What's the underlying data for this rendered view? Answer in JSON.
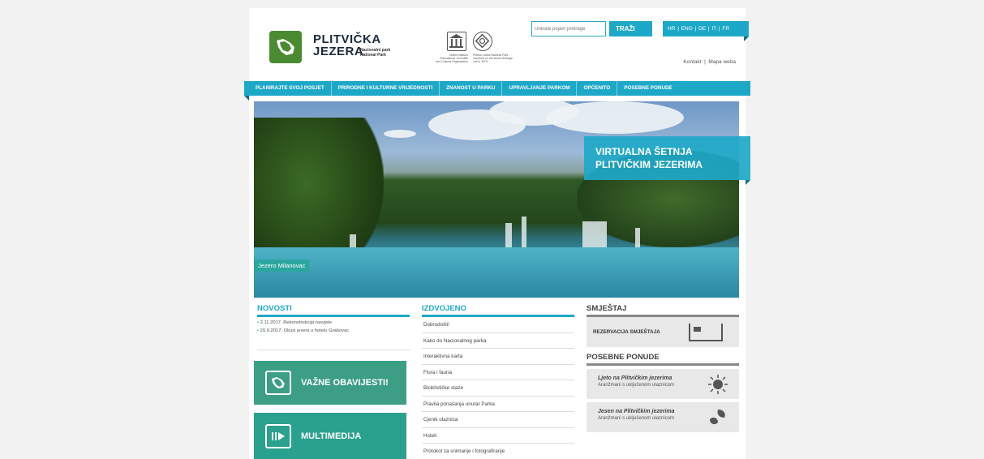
{
  "header": {
    "logo_title": "PLITVIČKA JEZERA",
    "logo_subtitle": "Nacionalni park National Park",
    "unesco_caption_left": "United Nations Educational, Scientific and Cultural Organization",
    "unesco_caption_right": "Plitvice Lakes National Park inscribed on the World Heritage List in 1979",
    "search_placeholder": "Unesite pojam pretrage",
    "search_button": "TRAŽI",
    "languages": "HR | ENG | DE | IT | FR",
    "contact": "Kontakt",
    "sitemap": "Mapa weba"
  },
  "nav": [
    "PLANIRAJTE SVOJ POSJET",
    "PRIRODNE I KULTURNE VRIJEDNOSTI",
    "ZNANOST U PARKU",
    "UPRAVLJANJE PARKOM",
    "OPĆENITO",
    "POSEBNE PONUDE"
  ],
  "hero": {
    "caption": "Jezero Milanovac",
    "virtual_tour_line1": "VIRTUALNA ŠETNJA",
    "virtual_tour_line2": "PLITVIČKIM JEZERIMA"
  },
  "news": {
    "title": "NOVOSTI",
    "items": [
      "2.11.2017. Rekonstrukcija rasvjete",
      "20.9.2017. Okusi jeseni u hotelu Grabovac"
    ]
  },
  "tiles": {
    "notices": "VAŽNE OBAVIJESTI!",
    "media": "MULTIMEDIJA"
  },
  "featured": {
    "title": "IZDVOJENO",
    "links": [
      "Dobrodošli!",
      "Kako do Nacionalnog parka",
      "Interaktivna karta",
      "Flora i fauna",
      "Biciklističke staze",
      "Pravila ponašanja unutar Parka",
      "Cjenik ulaznica",
      "Hoteli",
      "Protokol za snimanje i fotografiranje"
    ]
  },
  "accommodation": {
    "title": "SMJEŠTAJ",
    "booking": "REZERVACIJA SMJEŠTAJA"
  },
  "offers": {
    "title": "POSEBNE PONUDE",
    "items": [
      {
        "title": "Ljeto na Plitvičkim jezerima",
        "subtitle": "Aranžmani s uključenom ulaznicom"
      },
      {
        "title": "Jesen na Plitvičkim jezerima",
        "subtitle": "Aranžmani s uključenom ulaznicom"
      }
    ]
  },
  "colors": {
    "accent": "#1ea8c8",
    "green": "#3d9e86",
    "background": "#f2f2f2"
  }
}
